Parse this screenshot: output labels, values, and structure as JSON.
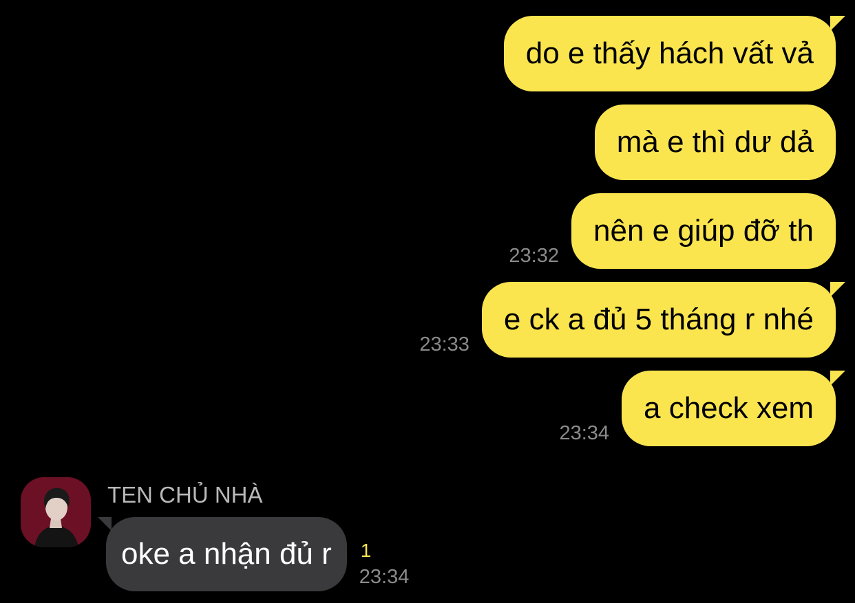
{
  "messages_out": [
    {
      "text": "do e thấy hách vất vả",
      "time": ""
    },
    {
      "text": "mà e thì dư dả",
      "time": ""
    },
    {
      "text": "nên e giúp đỡ th",
      "time": "23:32"
    },
    {
      "text": "e ck a đủ 5 tháng r nhé",
      "time": "23:33"
    },
    {
      "text": "a check xem",
      "time": "23:34"
    }
  ],
  "incoming": {
    "sender": "TEN CHỦ NHÀ",
    "avatar_icon": "contact-avatar",
    "text": "oke a nhận đủ r",
    "unread_count": "1",
    "time": "23:34"
  },
  "colors": {
    "background": "#000000",
    "outgoing_bubble": "#fae54f",
    "incoming_bubble": "#3a3a3c",
    "timestamp": "#8a8a8a",
    "unread": "#fae54f"
  }
}
